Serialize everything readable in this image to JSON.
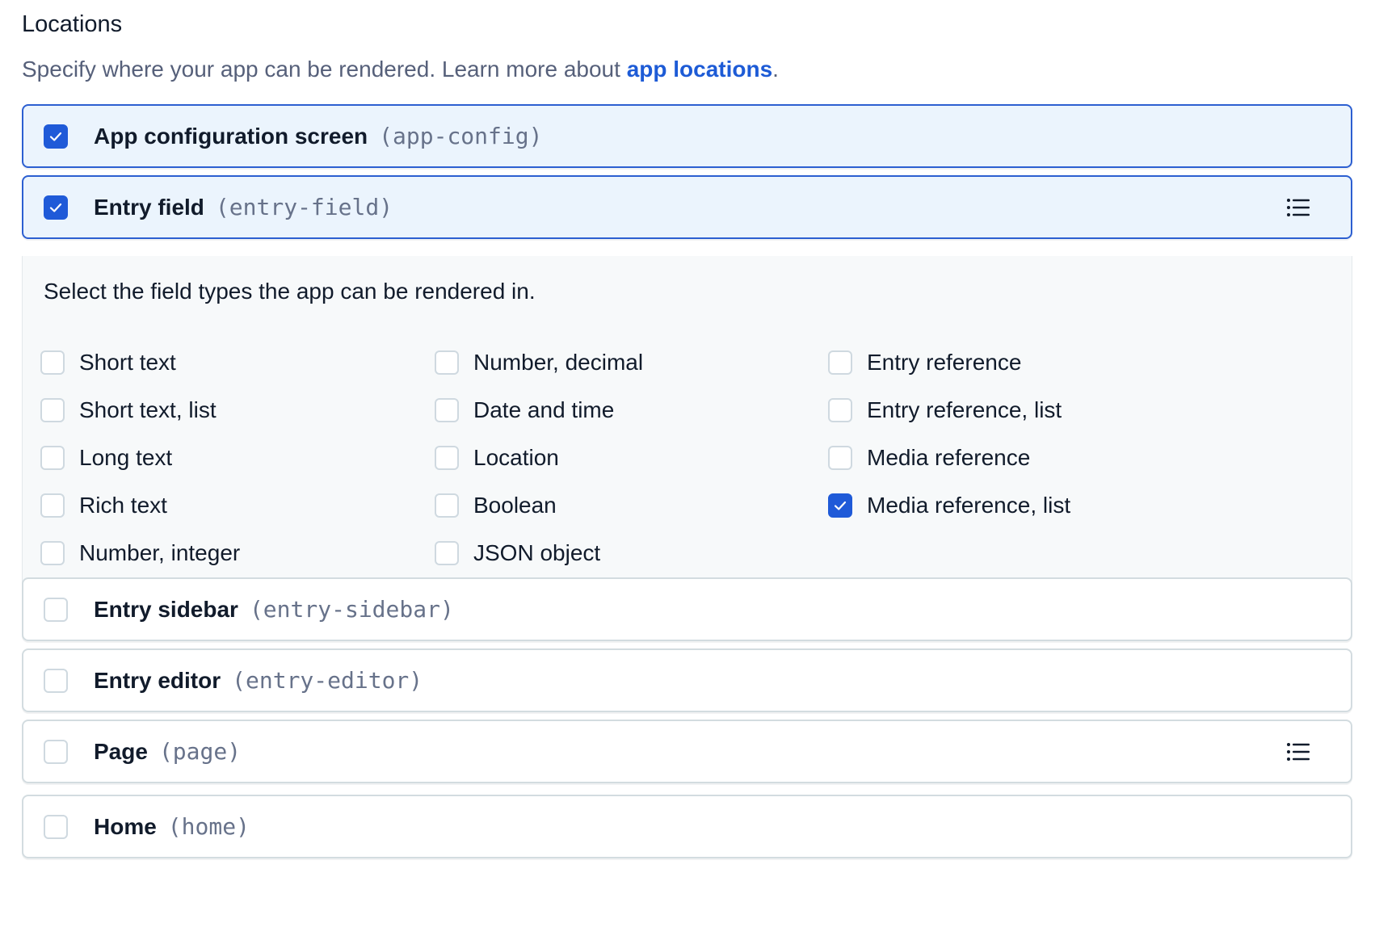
{
  "section": {
    "title": "Locations",
    "description_prefix": "Specify where your app can be rendered. Learn more about ",
    "description_link": "app locations",
    "description_suffix": "."
  },
  "locations": [
    {
      "label": "App configuration screen",
      "code": "(app-config)",
      "checked": true
    },
    {
      "label": "Entry field",
      "code": "(entry-field)",
      "checked": true
    },
    {
      "label": "Entry sidebar",
      "code": "(entry-sidebar)",
      "checked": false
    },
    {
      "label": "Entry editor",
      "code": "(entry-editor)",
      "checked": false
    },
    {
      "label": "Page",
      "code": "(page)",
      "checked": false
    },
    {
      "label": "Home",
      "code": "(home)",
      "checked": false
    }
  ],
  "field_types": {
    "hint": "Select the field types the app can be rendered in.",
    "columns": [
      [
        {
          "label": "Short text",
          "checked": false
        },
        {
          "label": "Short text, list",
          "checked": false
        },
        {
          "label": "Long text",
          "checked": false
        },
        {
          "label": "Rich text",
          "checked": false
        },
        {
          "label": "Number, integer",
          "checked": false
        }
      ],
      [
        {
          "label": "Number, decimal",
          "checked": false
        },
        {
          "label": "Date and time",
          "checked": false
        },
        {
          "label": "Location",
          "checked": false
        },
        {
          "label": "Boolean",
          "checked": false
        },
        {
          "label": "JSON object",
          "checked": false
        }
      ],
      [
        {
          "label": "Entry reference",
          "checked": false
        },
        {
          "label": "Entry reference, list",
          "checked": false
        },
        {
          "label": "Media reference",
          "checked": false
        },
        {
          "label": "Media reference, list",
          "checked": true
        }
      ]
    ]
  },
  "colors": {
    "accent": "#1f5ad8",
    "link": "#1d5bd6",
    "active_bg": "#ebf4fd",
    "active_border": "#2c5fd1"
  },
  "icons": {
    "check": "check-icon",
    "menu": "list-icon"
  }
}
